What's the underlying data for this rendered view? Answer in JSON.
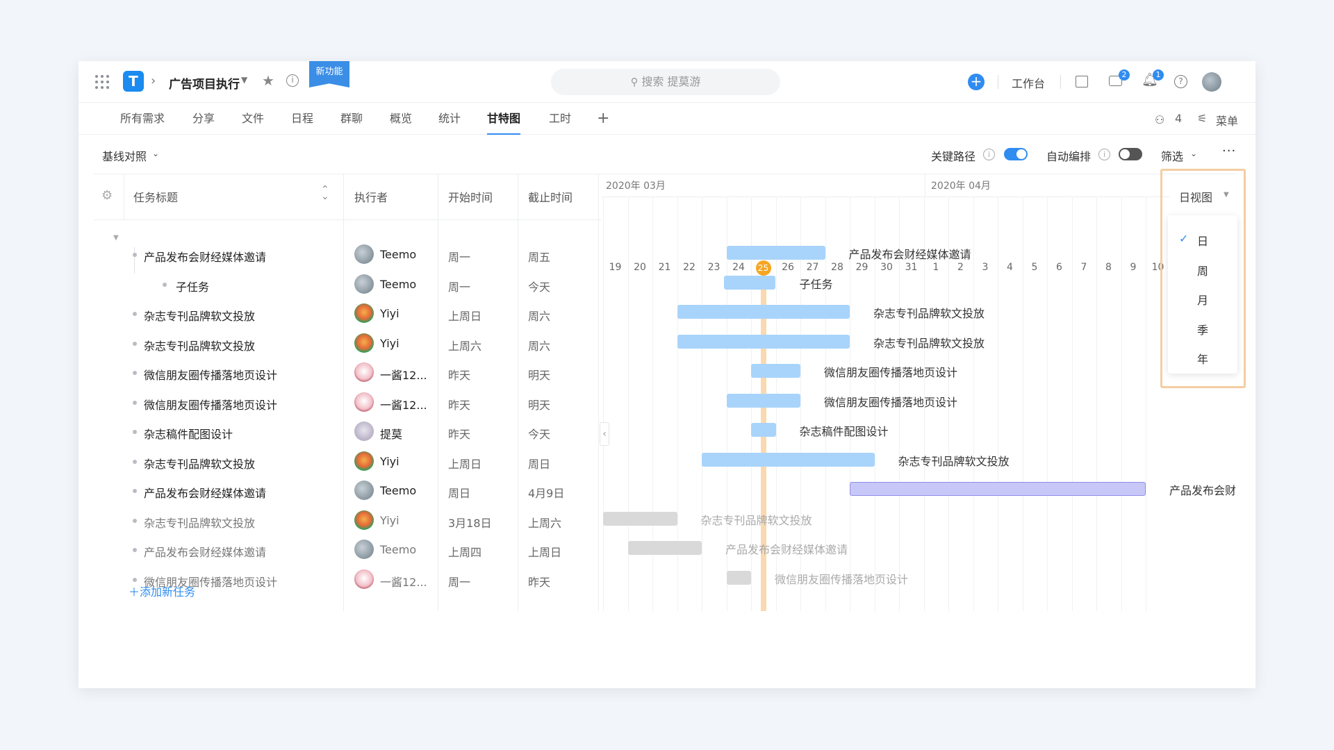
{
  "topbar": {
    "project_name": "广告项目执行",
    "new_feature_tag": "新功能",
    "search_placeholder": "搜索 提莫游",
    "workbench_label": "工作台",
    "messages_badge": "2",
    "notifications_badge": "1"
  },
  "tabs": [
    {
      "label": "所有需求"
    },
    {
      "label": "分享"
    },
    {
      "label": "文件"
    },
    {
      "label": "日程"
    },
    {
      "label": "群聊"
    },
    {
      "label": "概览"
    },
    {
      "label": "统计"
    },
    {
      "label": "甘特图",
      "active": true
    },
    {
      "label": "工时"
    }
  ],
  "tabbar_right": {
    "member_count": "4",
    "menu_label": "菜单"
  },
  "toolbar": {
    "baseline_label": "基线对照",
    "critical_path_label": "关键路径",
    "critical_path_on": true,
    "auto_schedule_label": "自动编排",
    "auto_schedule_on": false,
    "filter_label": "筛选"
  },
  "table": {
    "headers": {
      "title": "任务标题",
      "assignee": "执行者",
      "start": "开始时间",
      "end": "截止时间"
    },
    "rows": [
      {
        "title": "产品发布会财经媒体邀请",
        "assignee": "Teemo",
        "start": "周一",
        "end": "周五"
      },
      {
        "title": "子任务",
        "assignee": "Teemo",
        "start": "周一",
        "end": "今天"
      },
      {
        "title": "杂志专刊品牌软文投放",
        "assignee": "Yiyi",
        "start": "上周日",
        "end": "周六"
      },
      {
        "title": "杂志专刊品牌软文投放",
        "assignee": "Yiyi",
        "start": "上周六",
        "end": "周六"
      },
      {
        "title": "微信朋友圈传播落地页设计",
        "assignee": "一酱12...",
        "start": "昨天",
        "end": "明天"
      },
      {
        "title": "微信朋友圈传播落地页设计",
        "assignee": "一酱12...",
        "start": "昨天",
        "end": "明天"
      },
      {
        "title": "杂志稿件配图设计",
        "assignee": "提莫",
        "start": "昨天",
        "end": "今天"
      },
      {
        "title": "杂志专刊品牌软文投放",
        "assignee": "Yiyi",
        "start": "上周日",
        "end": "周日"
      },
      {
        "title": "产品发布会财经媒体邀请",
        "assignee": "Teemo",
        "start": "周日",
        "end": "4月9日"
      },
      {
        "title": "杂志专刊品牌软文投放",
        "assignee": "Yiyi",
        "start": "3月18日",
        "end": "上周六"
      },
      {
        "title": "产品发布会财经媒体邀请",
        "assignee": "Teemo",
        "start": "上周四",
        "end": "上周日"
      },
      {
        "title": "微信朋友圈传播落地页设计",
        "assignee": "一酱12...",
        "start": "周一",
        "end": "昨天"
      }
    ],
    "add_task_label": "添加新任务"
  },
  "gantt": {
    "month_labels": [
      "2020年 03月",
      "2020年 04月"
    ],
    "days": [
      "19",
      "20",
      "21",
      "22",
      "23",
      "24",
      "25",
      "26",
      "27",
      "28",
      "29",
      "30",
      "31",
      "1",
      "2",
      "3",
      "4",
      "5",
      "6",
      "7",
      "8",
      "9",
      "10"
    ],
    "today": "25",
    "bar_labels": [
      "产品发布会财经媒体邀请",
      "子任务",
      "杂志专刊品牌软文投放",
      "杂志专刊品牌软文投放",
      "微信朋友圈传播落地页设计",
      "微信朋友圈传播落地页设计",
      "杂志稿件配图设计",
      "杂志专刊品牌软文投放",
      "产品发布会财",
      "杂志专刊品牌软文投放",
      "产品发布会财经媒体邀请",
      "微信朋友圈传播落地页设计"
    ]
  },
  "view_dropdown": {
    "label": "日视图",
    "options": [
      "日",
      "周",
      "月",
      "季",
      "年"
    ],
    "selected": "日"
  },
  "colors": {
    "accent": "#2f8cf0",
    "bar_blue": "#a8d4fb",
    "bar_purple": "#c8c8f8",
    "bar_gray": "#d9d9d9",
    "today_line": "#fbd9b0",
    "today_badge": "#f5a623",
    "highlight_frame": "#f4cda1"
  }
}
